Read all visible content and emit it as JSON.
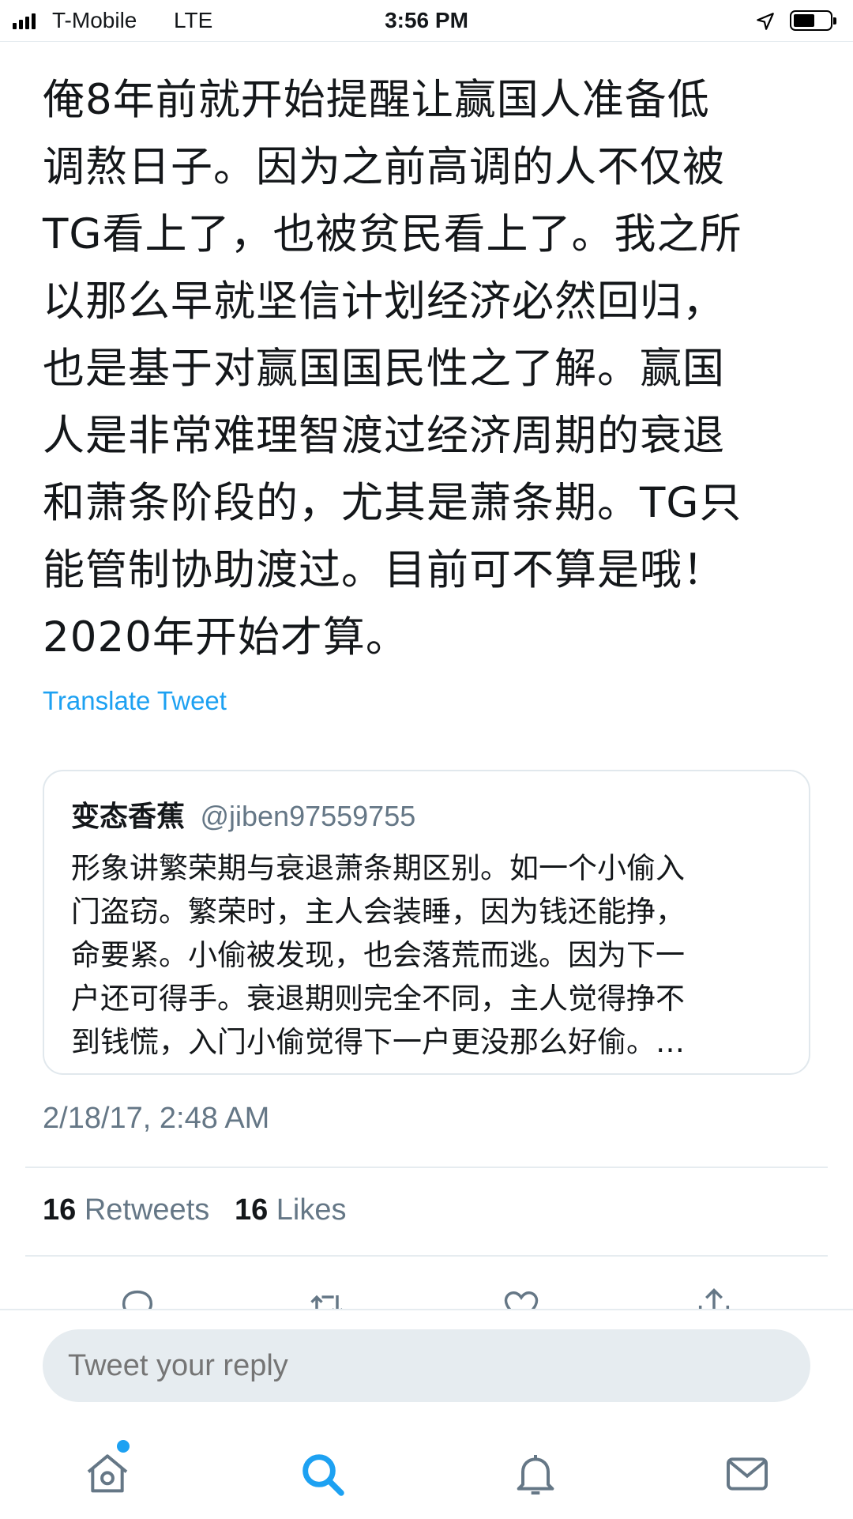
{
  "status_bar": {
    "carrier": "T-Mobile",
    "network": "LTE",
    "time": "3:56 PM"
  },
  "tweet": {
    "lines": [
      "俺8年前就开始提醒让赢国人准备低",
      "调熬日子。因为之前高调的人不仅被",
      "TG看上了，也被贫民看上了。我之所",
      "以那么早就坚信计划经济必然回归，",
      "也是基于对赢国国民性之了解。赢国",
      "人是非常难理智渡过经济周期的衰退",
      "和萧条阶段的，尤其是萧条期。TG只",
      "能管制协助渡过。目前可不算是哦！",
      "2020年开始才算。"
    ],
    "translate_label": "Translate Tweet",
    "timestamp": "2/18/17, 2:48 AM",
    "retweets_count": "16",
    "retweets_label": "Retweets",
    "likes_count": "16",
    "likes_label": "Likes"
  },
  "quoted_tweet": {
    "name": "变态香蕉",
    "handle": "@jiben97559755",
    "lines": [
      "形象讲繁荣期与衰退萧条期区别。如一个小偷入",
      "门盗窃。繁荣时，主人会装睡，因为钱还能挣，",
      "命要紧。小偷被发现，也会落荒而逃。因为下一",
      "户还可得手。衰退期则完全不同，主人觉得挣不",
      "到钱慌，入门小偷觉得下一户更没那么好偷。…"
    ]
  },
  "reply": {
    "placeholder": "Tweet your reply"
  },
  "colors": {
    "accent": "#1da1f2",
    "secondary_text": "#657786",
    "divider": "#e6ecf0"
  },
  "icons": {
    "actions": [
      "reply-icon",
      "retweet-icon",
      "like-icon",
      "share-icon"
    ],
    "nav": [
      "home-icon",
      "search-icon",
      "notifications-icon",
      "messages-icon"
    ]
  }
}
